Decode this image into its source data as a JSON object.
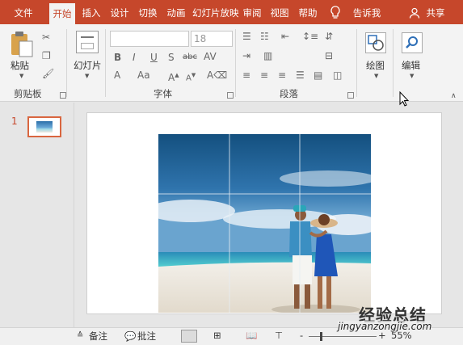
{
  "tabs": [
    {
      "label": "文件",
      "active": false
    },
    {
      "label": "开始",
      "active": true
    },
    {
      "label": "插入",
      "active": false
    },
    {
      "label": "设计",
      "active": false
    },
    {
      "label": "切换",
      "active": false
    },
    {
      "label": "动画",
      "active": false
    },
    {
      "label": "幻灯片放映",
      "active": false
    },
    {
      "label": "审阅",
      "active": false
    },
    {
      "label": "视图",
      "active": false
    },
    {
      "label": "帮助",
      "active": false
    }
  ],
  "tell_me": "告诉我",
  "share": "共享",
  "clipboard": {
    "paste": "粘贴",
    "group": "剪贴板"
  },
  "slides": {
    "new_slide": "幻灯片"
  },
  "font": {
    "font_size": "18",
    "group": "字体",
    "bold": "B",
    "italic": "I",
    "underline": "U",
    "strike": "S",
    "abc": "abc",
    "aa": "Aa",
    "font_color": "A"
  },
  "paragraph": {
    "group": "段落"
  },
  "drawing": {
    "label": "绘图"
  },
  "editing": {
    "label": "编辑"
  },
  "thumbnails": [
    {
      "number": "1",
      "selected": true
    }
  ],
  "status": {
    "notes": "备注",
    "comments": "批注",
    "zoom": "55%"
  },
  "watermark": {
    "title": "经验总结",
    "url": "jingyanzongjie.com"
  },
  "colors": {
    "accent": "#c6472b"
  }
}
